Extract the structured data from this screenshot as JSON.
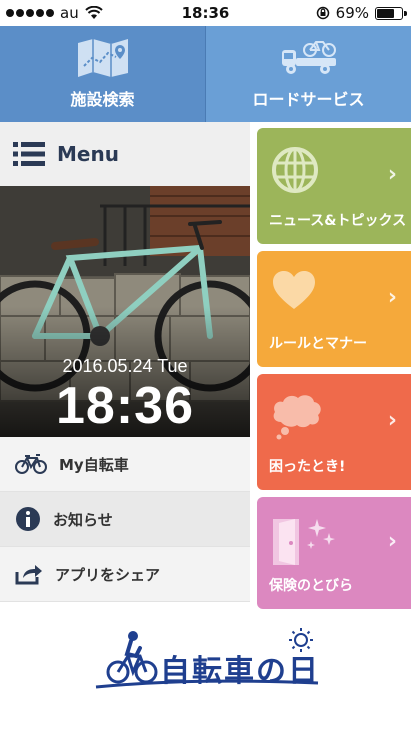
{
  "status_bar": {
    "carrier": "au",
    "time": "18:36",
    "battery": "69%",
    "battery_level": 0.69
  },
  "top_nav": {
    "facility_label": "施設検索",
    "road_label": "ロードサービス"
  },
  "menu": {
    "title": "Menu"
  },
  "photo": {
    "date": "2016.05.24 Tue",
    "time": "18:36"
  },
  "left_items": [
    {
      "label": "My自転車"
    },
    {
      "label": "お知らせ"
    },
    {
      "label": "アプリをシェア"
    }
  ],
  "tiles": [
    {
      "label": "ニュース&トピックス",
      "color": "#9cb55a"
    },
    {
      "label": "ルールとマナー",
      "color": "#f5a93b"
    },
    {
      "label": "困ったとき!",
      "color": "#ef6a4b"
    },
    {
      "label": "保険のとびら",
      "color": "#dc88c0"
    }
  ],
  "logo": {
    "text": "自転車の日"
  },
  "colors": {
    "nav_left": "#5b8ec8",
    "nav_right": "#6a9fd6",
    "logo_blue": "#1f3f8f"
  }
}
